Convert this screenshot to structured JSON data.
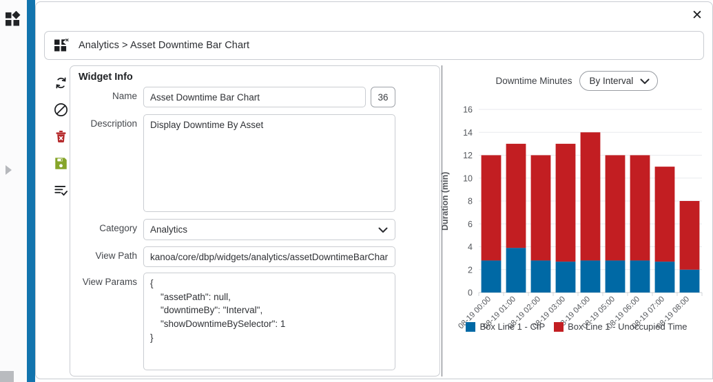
{
  "window": {
    "close_label": "✕"
  },
  "left_rail": {
    "apps_icon": "apps-grid-icon",
    "expand_icon": "expand-arrow-icon",
    "accent_color": "#1274ae"
  },
  "breadcrumb": {
    "icon": "widget-remove-icon",
    "text": "Analytics > Asset Downtime Bar Chart"
  },
  "tool_rail": {
    "items": [
      {
        "name": "refresh-button",
        "icon": "refresh-icon",
        "color": "#1a1c1f",
        "title": "Refresh"
      },
      {
        "name": "cancel-button",
        "icon": "prohibit-icon",
        "color": "#1a1c1f",
        "title": "Cancel"
      },
      {
        "name": "delete-button",
        "icon": "trash-delete-icon",
        "color": "#b5282a",
        "title": "Delete"
      },
      {
        "name": "save-button",
        "icon": "floppy-save-icon",
        "color": "#86a52a",
        "title": "Save"
      },
      {
        "name": "list-check-button",
        "icon": "list-check-icon",
        "color": "#1a1c1f",
        "title": "List"
      }
    ]
  },
  "widget_info": {
    "title": "Widget Info",
    "name": {
      "label": "Name",
      "value": "Asset Downtime Bar Chart",
      "placeholder": "",
      "char_count": "36"
    },
    "description": {
      "label": "Description",
      "value": "Display Downtime By Asset",
      "placeholder": ""
    },
    "category": {
      "label": "Category",
      "value": "Analytics",
      "options": [
        "Analytics"
      ]
    },
    "view_path": {
      "label": "View Path",
      "value": "kanoa/core/dbp/widgets/analytics/assetDowntimeBarChar",
      "placeholder": ""
    },
    "view_params": {
      "label": "View Params",
      "value": "{\n    \"assetPath\": null,\n    \"downtimeBy\": \"Interval\",\n    \"showDowntimeBySelector\": 1\n}",
      "placeholder": ""
    }
  },
  "chart_panel": {
    "downtime_label": "Downtime Minutes",
    "interval_select": {
      "value": "By Interval",
      "options": [
        "By Interval"
      ]
    }
  },
  "chart_data": {
    "type": "bar",
    "stacked": true,
    "title": "",
    "xlabel": "",
    "ylabel": "Duration (min)",
    "ylim": [
      0,
      16
    ],
    "yticks": [
      0,
      2,
      4,
      6,
      8,
      10,
      12,
      14,
      16
    ],
    "grid": true,
    "legend_position": "bottom",
    "categories": [
      "08-19 00:00",
      "08-19 01:00",
      "08-19 02:00",
      "08-19 03:00",
      "08-19 04:00",
      "08-19 05:00",
      "08-19 06:00",
      "08-19 07:00",
      "08-19 08:00"
    ],
    "series": [
      {
        "name": "Box Line 1 - CIP",
        "color": "#0069a5",
        "values": [
          2.8,
          3.9,
          2.8,
          2.7,
          2.8,
          2.8,
          2.8,
          2.7,
          2.0
        ]
      },
      {
        "name": "Box Line 1 - Unoccupied Time",
        "color": "#c21e22",
        "values": [
          9.2,
          9.1,
          9.2,
          10.3,
          11.2,
          9.2,
          9.2,
          8.3,
          6.0
        ]
      }
    ],
    "totals": [
      12,
      13,
      12,
      13,
      14,
      12,
      12,
      11,
      8
    ]
  }
}
